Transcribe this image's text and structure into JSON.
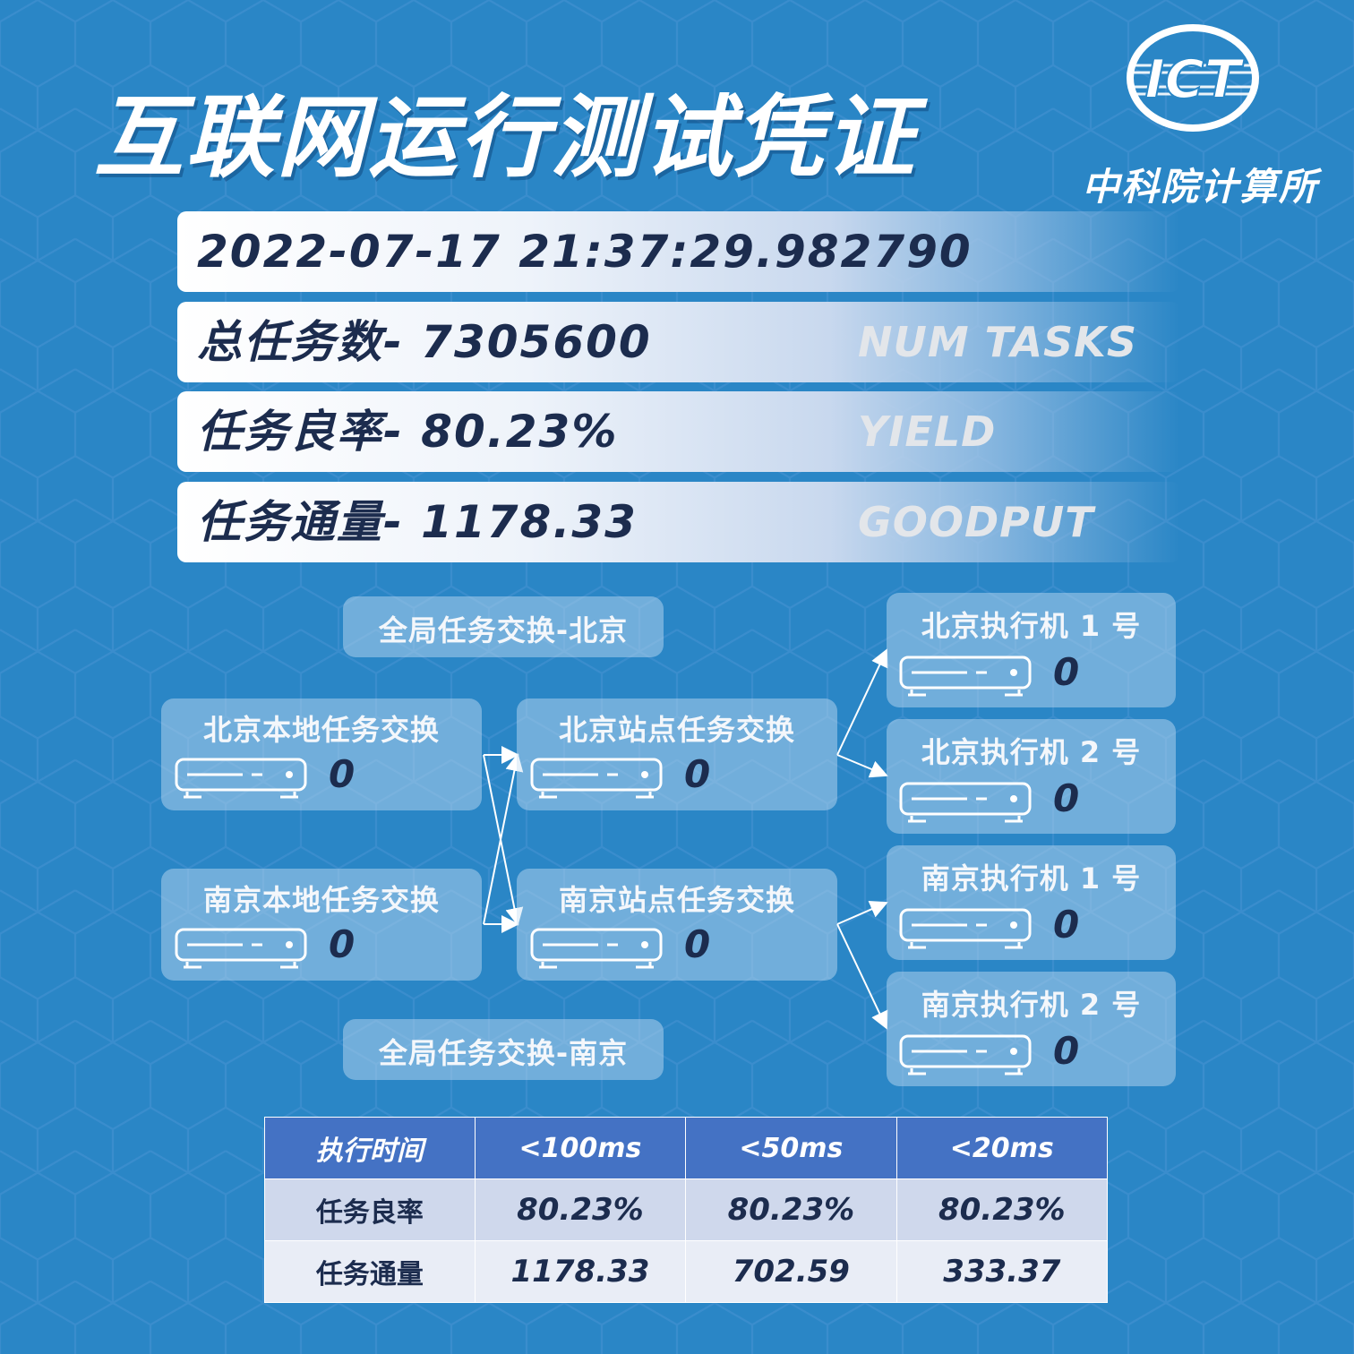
{
  "title": "互联网运行测试凭证",
  "logo": {
    "mark": "ICT",
    "org_name": "中科院计算所"
  },
  "stats": {
    "timestamp": "2022-07-17  21:37:29.982790",
    "num_tasks": {
      "label": "总任务数- 7305600",
      "en": "NUM TASKS"
    },
    "yield": {
      "label": "任务良率- 80.23%",
      "en": "YIELD"
    },
    "goodput": {
      "label": "任务通量- 1178.33",
      "en": "GOODPUT"
    }
  },
  "diagram": {
    "global_beijing": "全局任务交换-北京",
    "global_nanjing": "全局任务交换-南京",
    "nodes": [
      {
        "title": "北京本地任务交换",
        "value": "0"
      },
      {
        "title": "南京本地任务交换",
        "value": "0"
      },
      {
        "title": "北京站点任务交换",
        "value": "0"
      },
      {
        "title": "南京站点任务交换",
        "value": "0"
      },
      {
        "title": "北京执行机 1 号",
        "value": "0"
      },
      {
        "title": "北京执行机 2 号",
        "value": "0"
      },
      {
        "title": "南京执行机 1 号",
        "value": "0"
      },
      {
        "title": "南京执行机 2 号",
        "value": "0"
      }
    ]
  },
  "table": {
    "headers": [
      "执行时间",
      "<100ms",
      "<50ms",
      "<20ms"
    ],
    "rows": [
      [
        "任务良率",
        "80.23%",
        "80.23%",
        "80.23%"
      ],
      [
        "任务通量",
        "1178.33",
        "702.59",
        "333.37"
      ]
    ]
  },
  "colors": {
    "background": "#2a86c6",
    "text_dark": "#1c2c4e",
    "table_header": "#4472c4"
  }
}
